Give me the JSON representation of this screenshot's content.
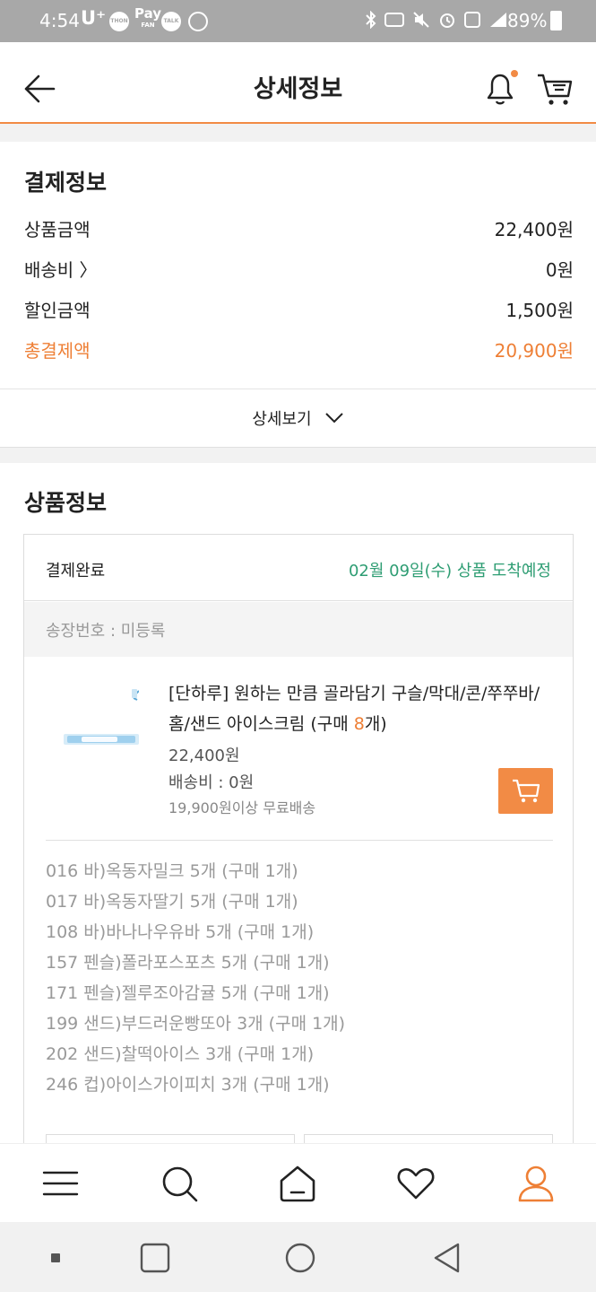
{
  "status_bar": {
    "time": "4:54",
    "carrier": "U⁺",
    "app_badge_1": "THON",
    "pay_label": "Pay",
    "pay_sub": "FAN",
    "talk_badge": "TALK",
    "battery": "89%",
    "icons": [
      "bluetooth-icon",
      "nfc-icon",
      "mute-icon",
      "alarm-icon",
      "lte-icon",
      "signal-icon",
      "battery-icon"
    ]
  },
  "header": {
    "title": "상세정보"
  },
  "payment": {
    "title": "결제정보",
    "rows": [
      {
        "label": "상품금액",
        "value": "22,400원"
      },
      {
        "label": "배송비 〉",
        "value": "0원"
      },
      {
        "label": "할인금액",
        "value": "1,500원"
      },
      {
        "label": "총결제액",
        "value": "20,900원"
      }
    ],
    "detail_label": "상세보기"
  },
  "product": {
    "title": "상품정보",
    "order_status": "결제완료",
    "eta": "02월 09일(수) 상품 도착예정",
    "tracking": "송장번호 : 미등록",
    "name_prefix": "[단하루] 원하는 만큼 골라담기 구슬/막대/콘/쭈쭈바/홈/샌드 아이스크림 (구매 ",
    "name_qty": "8",
    "name_suffix": "개)",
    "price": "22,400원",
    "shipping": "배송비 : 0원",
    "free_shipping": "19,900원이상 무료배송",
    "options": [
      "016 바)옥동자밀크 5개 (구매 1개)",
      "017 바)옥동자딸기 5개 (구매 1개)",
      "108 바)바나나우유바 5개 (구매 1개)",
      "157 펜슬)폴라포스포츠 5개 (구매 1개)",
      "171 펜슬)젤루조아감귤 5개 (구매 1개)",
      "199 샌드)부드러운빵또아 3개 (구매 1개)",
      "202 샌드)찰떡아이스 3개 (구매 1개)",
      "246 컵)아이스가이피치 3개 (구매 1개)"
    ]
  },
  "colors": {
    "accent": "#f28b45",
    "total_text": "#ee7f35",
    "eta_green": "#2e9d73"
  }
}
